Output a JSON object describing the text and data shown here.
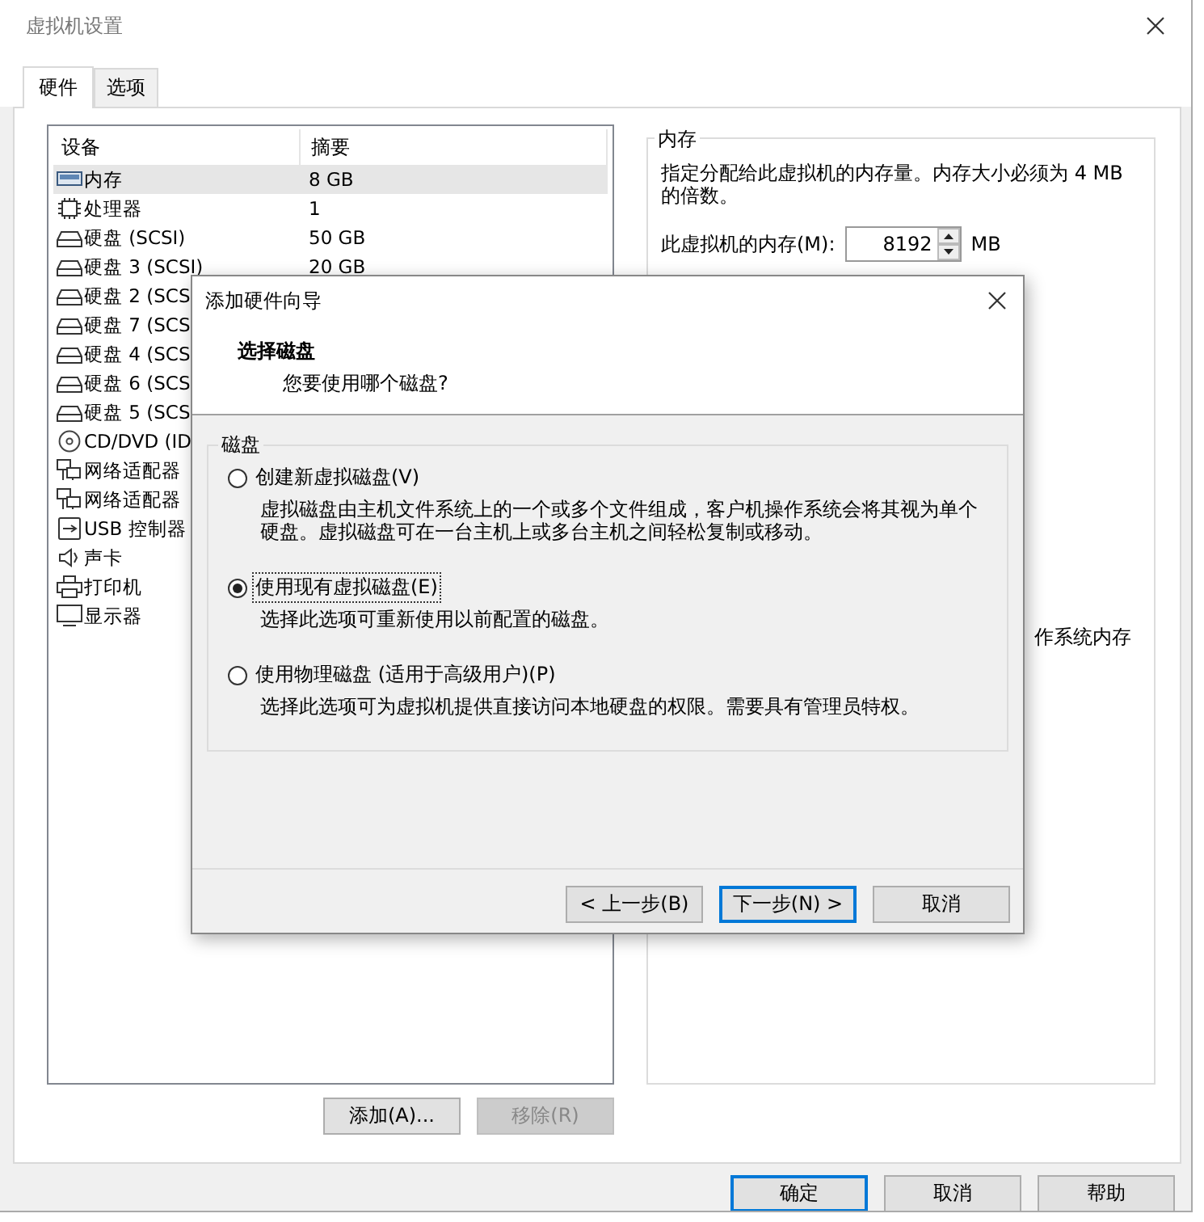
{
  "window": {
    "title": "虚拟机设置"
  },
  "tabs": [
    {
      "label": "硬件",
      "selected": true
    },
    {
      "label": "选项",
      "selected": false
    }
  ],
  "device_list": {
    "columns": [
      "设备",
      "摘要"
    ],
    "rows": [
      {
        "kind": "memory",
        "device": "内存",
        "summary": "8 GB",
        "selected": true
      },
      {
        "kind": "processor",
        "device": "处理器",
        "summary": "1",
        "selected": false
      },
      {
        "kind": "disk",
        "device": "硬盘 (SCSI)",
        "summary": "50 GB",
        "selected": false
      },
      {
        "kind": "disk",
        "device": "硬盘 3 (SCSI)",
        "summary": "20 GB",
        "selected": false
      },
      {
        "kind": "disk",
        "device": "硬盘 2 (SCS",
        "selected": false
      },
      {
        "kind": "disk",
        "device": "硬盘 7 (SCS",
        "selected": false
      },
      {
        "kind": "disk",
        "device": "硬盘 4 (SCS",
        "selected": false
      },
      {
        "kind": "disk",
        "device": "硬盘 6 (SCS",
        "selected": false
      },
      {
        "kind": "disk",
        "device": "硬盘 5 (SCS",
        "selected": false
      },
      {
        "kind": "cd",
        "device": "CD/DVD (ID",
        "selected": false
      },
      {
        "kind": "network",
        "device": "网络适配器",
        "selected": false
      },
      {
        "kind": "network",
        "device": "网络适配器",
        "selected": false
      },
      {
        "kind": "usb",
        "device": "USB 控制器",
        "selected": false
      },
      {
        "kind": "sound",
        "device": "声卡",
        "selected": false
      },
      {
        "kind": "printer",
        "device": "打印机",
        "selected": false
      },
      {
        "kind": "display",
        "device": "显示器",
        "selected": false
      }
    ]
  },
  "device_buttons": [
    {
      "label": "添加(A)...",
      "disabled": false
    },
    {
      "label": "移除(R)",
      "disabled": true
    }
  ],
  "memory_panel": {
    "title": "内存",
    "description": "指定分配给此虚拟机的内存量。内存大小必须为 4 MB 的倍数。",
    "field_label": "此虚拟机的内存(M):",
    "value": "8192",
    "unit": "MB",
    "partial_text": "作系统内存"
  },
  "dialog": {
    "title": "添加硬件向导",
    "heading": "选择磁盘",
    "subheading": "您要使用哪个磁盘?",
    "group_label": "磁盘",
    "options": [
      {
        "label": "创建新虚拟磁盘(V)",
        "description": "虚拟磁盘由主机文件系统上的一个或多个文件组成，客户机操作系统会将其视为单个硬盘。虚拟磁盘可在一台主机上或多台主机之间轻松复制或移动。",
        "selected": false
      },
      {
        "label": "使用现有虚拟磁盘(E)",
        "description": "选择此选项可重新使用以前配置的磁盘。",
        "selected": true
      },
      {
        "label": "使用物理磁盘 (适用于高级用户)(P)",
        "description": "选择此选项可为虚拟机提供直接访问本地硬盘的权限。需要具有管理员特权。",
        "selected": false
      }
    ],
    "buttons": [
      {
        "label": "< 上一步(B)",
        "default": false
      },
      {
        "label": "下一步(N) >",
        "default": true
      },
      {
        "label": "取消",
        "default": false
      }
    ]
  },
  "footer_buttons": [
    {
      "label": "确定",
      "default": true
    },
    {
      "label": "取消",
      "default": false
    },
    {
      "label": "帮助",
      "default": false
    }
  ]
}
